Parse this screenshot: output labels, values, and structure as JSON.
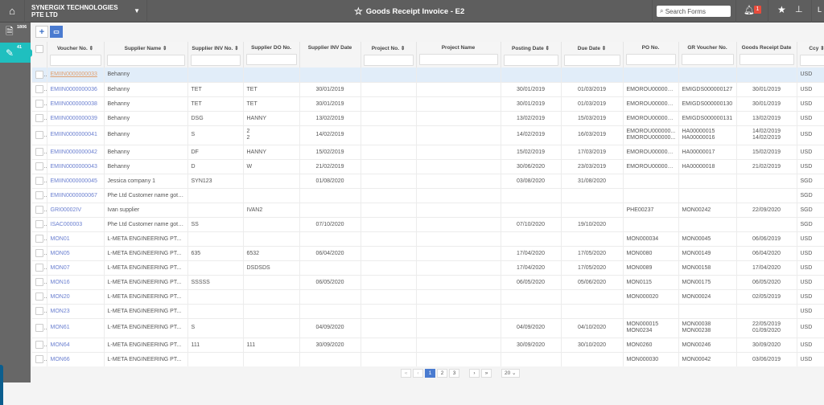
{
  "topbar": {
    "company": "SYNERGIX TECHNOLOGIES PTE LTD",
    "title": "Goods Receipt Invoice - E2",
    "search_placeholder": "Search Forms",
    "notification_count": "1",
    "user_initial": "L"
  },
  "sidebar": {
    "items": [
      {
        "icon": "document-icon",
        "count": "1806"
      },
      {
        "icon": "edit-icon",
        "count": "41"
      }
    ]
  },
  "toolbar": {
    "add": "+",
    "view": "▭"
  },
  "columns": [
    "",
    "Voucher No.",
    "Supplier Name",
    "Supplier INV No.",
    "Supplier DO No.",
    "Supplier INV Date",
    "Project No.",
    "Project Name",
    "Posting Date",
    "Due Date",
    "PO No.",
    "GR Voucher No.",
    "Goods Receipt Date",
    "Ccy"
  ],
  "sortable": [
    false,
    true,
    true,
    true,
    false,
    false,
    true,
    false,
    true,
    true,
    false,
    false,
    false,
    true
  ],
  "filterable": [
    false,
    true,
    true,
    true,
    true,
    false,
    true,
    true,
    true,
    true,
    true,
    true,
    true,
    true
  ],
  "rows": [
    [
      "EMIIN0000000033",
      "Behanny",
      "",
      "",
      "",
      "",
      "",
      "",
      "",
      "",
      "",
      "",
      "USD"
    ],
    [
      "EMIIN0000000036",
      "Behanny",
      "TET",
      "TET",
      "30/01/2019",
      "",
      "",
      "30/01/2019",
      "01/03/2019",
      "EMOROU000000...",
      "EMIGDS000000127",
      "30/01/2019",
      "USD"
    ],
    [
      "EMIIN0000000038",
      "Behanny",
      "TET",
      "TET",
      "30/01/2019",
      "",
      "",
      "30/01/2019",
      "01/03/2019",
      "EMOROU000000...",
      "EMIGDS000000130",
      "30/01/2019",
      "USD"
    ],
    [
      "EMIIN0000000039",
      "Behanny",
      "DSG",
      "HANNY",
      "13/02/2019",
      "",
      "",
      "13/02/2019",
      "15/03/2019",
      "EMOROU000000...",
      "EMIGDS000000131",
      "13/02/2019",
      "USD"
    ],
    [
      "EMIIN0000000041",
      "Behanny",
      "S",
      "2\n2",
      "14/02/2019",
      "",
      "",
      "14/02/2019",
      "16/03/2019",
      "EMOROU000000...\nEMOROU000000...",
      "HA00000015\nHA00000016",
      "14/02/2019\n14/02/2019",
      "USD"
    ],
    [
      "EMIIN0000000042",
      "Behanny",
      "DF",
      "HANNY",
      "15/02/2019",
      "",
      "",
      "15/02/2019",
      "17/03/2019",
      "EMOROU000000...",
      "HA00000017",
      "15/02/2019",
      "USD"
    ],
    [
      "EMIIN0000000043",
      "Behanny",
      "D",
      "W",
      "21/02/2019",
      "",
      "",
      "30/06/2020",
      "23/03/2019",
      "EMOROU000000...",
      "HA00000018",
      "21/02/2019",
      "USD"
    ],
    [
      "EMIIN0000000045",
      "Jessica company 1",
      "SYN123",
      "",
      "01/08/2020",
      "",
      "",
      "03/08/2020",
      "31/08/2020",
      "",
      "",
      "",
      "SGD"
    ],
    [
      "EMIIN0000000067",
      "Phe Ltd Customer name gott...",
      "",
      "",
      "",
      "",
      "",
      "",
      "",
      "",
      "",
      "",
      "SGD"
    ],
    [
      "GRI00002IV",
      "Ivan supplier",
      "",
      "IVAN2",
      "",
      "",
      "",
      "",
      "",
      "PHE00237",
      "MON00242",
      "22/09/2020",
      "SGD"
    ],
    [
      "ISAC000003",
      "Phe Ltd Customer name gott...",
      "SS",
      "",
      "07/10/2020",
      "",
      "",
      "07/10/2020",
      "19/10/2020",
      "",
      "",
      "",
      "SGD"
    ],
    [
      "MON01",
      "L-META ENGINEERING PT...",
      "",
      "",
      "",
      "",
      "",
      "",
      "",
      "MON000034",
      "MON00045",
      "06/06/2019",
      "USD"
    ],
    [
      "MON05",
      "L-META ENGINEERING PT...",
      "635",
      "6532",
      "06/04/2020",
      "",
      "",
      "17/04/2020",
      "17/05/2020",
      "MON0080",
      "MON00149",
      "06/04/2020",
      "USD"
    ],
    [
      "MON07",
      "L-META ENGINEERING PT...",
      "",
      "DSDSDS",
      "",
      "",
      "",
      "17/04/2020",
      "17/05/2020",
      "MON0089",
      "MON00158",
      "17/04/2020",
      "USD"
    ],
    [
      "MON16",
      "L-META ENGINEERING PT...",
      "SSSSS",
      "",
      "06/05/2020",
      "",
      "",
      "06/05/2020",
      "05/06/2020",
      "MON0115",
      "MON00175",
      "06/05/2020",
      "USD"
    ],
    [
      "MON20",
      "L-META ENGINEERING PT...",
      "",
      "",
      "",
      "",
      "",
      "",
      "",
      "MON000020",
      "MON00024",
      "02/05/2019",
      "USD"
    ],
    [
      "MON23",
      "L-META ENGINEERING PT...",
      "",
      "",
      "",
      "",
      "",
      "",
      "",
      "",
      "",
      "",
      "USD"
    ],
    [
      "MON61",
      "L-META ENGINEERING PT...",
      "S",
      "",
      "04/09/2020",
      "",
      "",
      "04/09/2020",
      "04/10/2020",
      "MON000015\nMON0234",
      "MON00038\nMON00238",
      "22/05/2019\n01/09/2020",
      "USD"
    ],
    [
      "MON64",
      "L-META ENGINEERING PT...",
      "111",
      "111",
      "30/09/2020",
      "",
      "",
      "30/09/2020",
      "30/10/2020",
      "MON0260",
      "MON00246",
      "30/09/2020",
      "USD"
    ],
    [
      "MON66",
      "L-META ENGINEERING PT...",
      "",
      "",
      "",
      "",
      "",
      "",
      "",
      "MON000030",
      "MON00042",
      "03/06/2019",
      "USD"
    ]
  ],
  "pagination": {
    "first": "«",
    "prev": "‹",
    "pages": [
      "1",
      "2",
      "3"
    ],
    "current": "1",
    "next": "›",
    "last": "»",
    "page_size": "20"
  }
}
